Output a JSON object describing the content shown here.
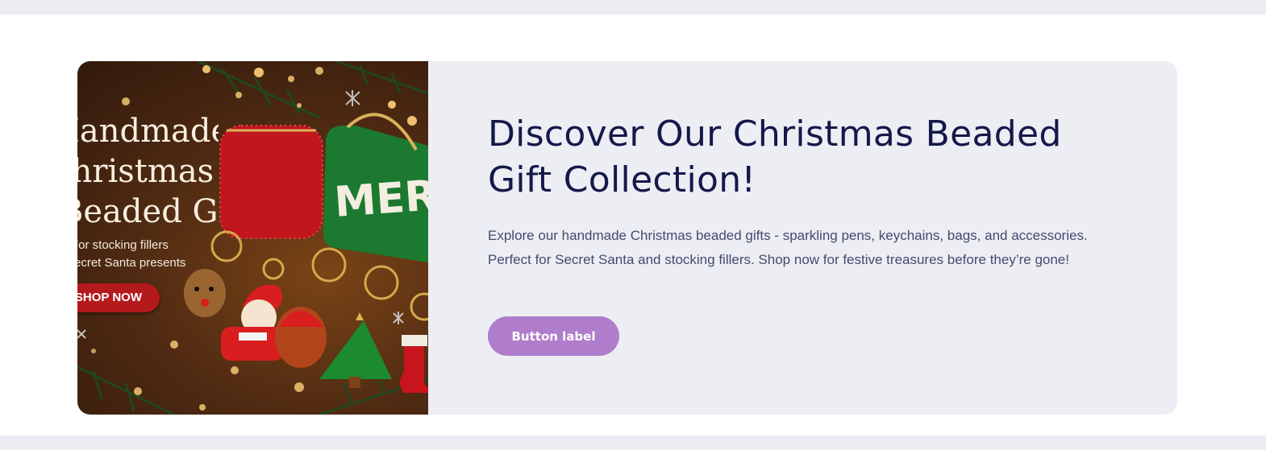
{
  "promo": {
    "image": {
      "title_lines": [
        "Handmade",
        "Christmas",
        "Beaded Gifts"
      ],
      "subtitle_lines": [
        "For stocking fillers",
        "Secret Santa presents"
      ],
      "shop_button": "SHOP NOW",
      "bag_text": "MERRY",
      "colors": {
        "red_bag": "#c0161c",
        "green_bag": "#1b7a2f",
        "shop_button": "#b4191c"
      }
    },
    "headline": "Discover Our Christmas Beaded Gift Collection!",
    "description": "Explore our handmade Christmas beaded gifts - sparkling pens, keychains, bags, and accessories. Perfect for Secret Santa and stocking fillers. Shop now for festive treasures before they’re gone!",
    "button_label": "Button label",
    "colors": {
      "page_background": "#ecedf3",
      "card_background": "#edeef4",
      "headline": "#14194a",
      "body_text": "#434a6e",
      "button": "#b07ccc"
    }
  }
}
